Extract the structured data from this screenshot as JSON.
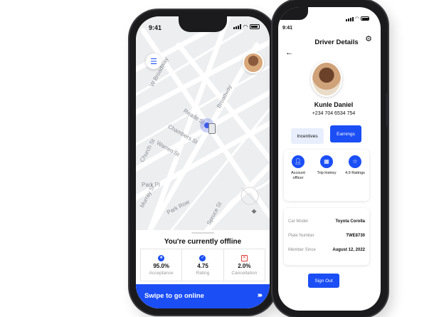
{
  "left_phone": {
    "status_time": "9:41",
    "map": {
      "streets": [
        "Reade St",
        "Chambers St",
        "Warren St",
        "Broadway",
        "Park Pl",
        "Park Row",
        "Spruce St",
        "W Broadway",
        "Murray St",
        "Church St"
      ]
    },
    "offline_title": "You're currently offline",
    "stats": [
      {
        "icon": "star-icon",
        "value": "95.0%",
        "label": "Acceptance",
        "color": "#1b4ef5"
      },
      {
        "icon": "check-icon",
        "value": "4.75",
        "label": "Rating",
        "color": "#1b4ef5"
      },
      {
        "icon": "x-icon",
        "value": "2.0%",
        "label": "Cancellation",
        "color": "#e0413a"
      }
    ],
    "swipe_label": "Swipe to go online",
    "swipe_arrows": "››››"
  },
  "right_phone": {
    "status_time": "9:41",
    "title": "Driver Details",
    "name": "Kunle Daniel",
    "phone": "+234 704 6534 754",
    "buttons": {
      "incentives": "Incentives",
      "earnings": "Earnings"
    },
    "quick_items": [
      {
        "icon": "person-icon",
        "label": "Account officer"
      },
      {
        "icon": "calendar-icon",
        "label": "Trip history"
      },
      {
        "icon": "star-icon",
        "label": "4.9 Ratings"
      }
    ],
    "details": [
      {
        "key": "Car Model",
        "value": "Toyota Corolla"
      },
      {
        "key": "Plate Number",
        "value": "TWE8730"
      },
      {
        "key": "Member Since",
        "value": "August 12, 2022"
      }
    ],
    "sign_out": "Sign Out"
  },
  "colors": {
    "accent": "#1b4ef5",
    "danger": "#e0413a",
    "map_bg": "#eceef0"
  }
}
